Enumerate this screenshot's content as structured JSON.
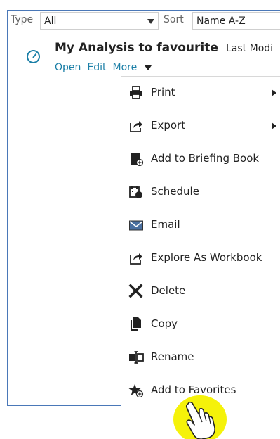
{
  "filter": {
    "type_label": "Type",
    "type_value": "All",
    "sort_label": "Sort",
    "sort_value": "Name A-Z"
  },
  "item": {
    "title": "My Analysis to favourite",
    "last_modified_label": "Last Modi",
    "actions": {
      "open": "Open",
      "edit": "Edit",
      "more": "More"
    }
  },
  "menu": {
    "items": [
      {
        "label": "Print",
        "icon": "printer-icon",
        "submenu": true
      },
      {
        "label": "Export",
        "icon": "export-icon",
        "submenu": true
      },
      {
        "label": "Add to Briefing Book",
        "icon": "briefing-book-icon",
        "submenu": false
      },
      {
        "label": "Schedule",
        "icon": "schedule-icon",
        "submenu": false
      },
      {
        "label": "Email",
        "icon": "email-icon",
        "submenu": false
      },
      {
        "label": "Explore As Workbook",
        "icon": "explore-icon",
        "submenu": false
      },
      {
        "label": "Delete",
        "icon": "delete-icon",
        "submenu": false
      },
      {
        "label": "Copy",
        "icon": "copy-icon",
        "submenu": false
      },
      {
        "label": "Rename",
        "icon": "rename-icon",
        "submenu": false
      },
      {
        "label": "Add to Favorites",
        "icon": "add-favorite-icon",
        "submenu": false
      }
    ]
  },
  "colors": {
    "accent": "#1b7fa7",
    "frame_border": "#4a78b8",
    "cursor_highlight": "#f5f20a"
  }
}
